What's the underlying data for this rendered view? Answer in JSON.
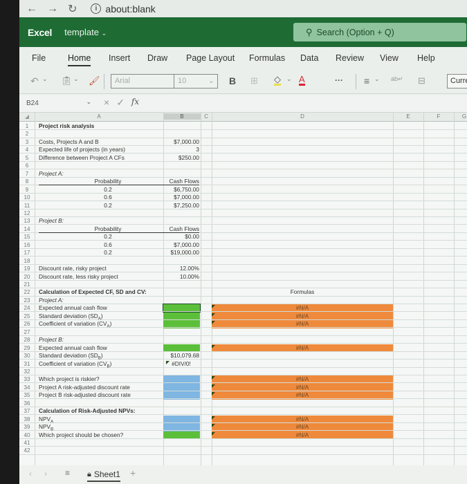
{
  "browser": {
    "back_icon": "arrow-left-icon",
    "forward_icon": "arrow-right-icon",
    "reload_icon": "reload-icon",
    "url": "about:blank"
  },
  "app": {
    "name": "Excel",
    "document": "template",
    "search_placeholder": "Search (Option + Q)"
  },
  "ribbon": {
    "tabs": [
      "File",
      "Home",
      "Insert",
      "Draw",
      "Page Layout",
      "Formulas",
      "Data",
      "Review",
      "View",
      "Help"
    ],
    "active_tab": "Home",
    "font_name": "Arial",
    "font_size": "10",
    "bold_label": "B",
    "more_label": "···",
    "number_format": "Currency"
  },
  "formula_bar": {
    "name_box": "B24",
    "cancel_icon": "×",
    "enter_icon": "✓",
    "fx_label": "fx",
    "value": ""
  },
  "columns": [
    "A",
    "B",
    "C",
    "D",
    "E",
    "F",
    "G"
  ],
  "selected_column": "B",
  "rows": [
    {
      "n": "1",
      "a": "Project risk analysis",
      "a_style": "bold"
    },
    {
      "n": "2"
    },
    {
      "n": "3",
      "a": "Costs, Projects A and B",
      "b": "$7,000.00"
    },
    {
      "n": "4",
      "a": "Expected life of projects (in years)",
      "b": "3"
    },
    {
      "n": "5",
      "a": "Difference between Project A CFs",
      "b": "$250.00"
    },
    {
      "n": "6"
    },
    {
      "n": "7",
      "a": "Project A:",
      "a_style": "ital"
    },
    {
      "n": "8",
      "mid": "Probability",
      "b": "Cash Flows"
    },
    {
      "n": "9",
      "mid": "0.2",
      "b": "$6,750.00"
    },
    {
      "n": "10",
      "mid": "0.6",
      "b": "$7,000.00"
    },
    {
      "n": "11",
      "mid": "0.2",
      "b": "$7,250.00"
    },
    {
      "n": "12"
    },
    {
      "n": "13",
      "a": "Project B:",
      "a_style": "ital"
    },
    {
      "n": "14",
      "mid": "Probability",
      "b": "Cash Flows"
    },
    {
      "n": "15",
      "mid": "0.2",
      "b": "$0.00"
    },
    {
      "n": "16",
      "mid": "0.6",
      "b": "$7,000.00"
    },
    {
      "n": "17",
      "mid": "0.2",
      "b": "$19,000.00"
    },
    {
      "n": "18"
    },
    {
      "n": "19",
      "a": "Discount rate, risky project",
      "b": "12.00%"
    },
    {
      "n": "20",
      "a": "Discount rate, less risky project",
      "b": "10.00%"
    },
    {
      "n": "21"
    },
    {
      "n": "22",
      "a": "Calculation of Expected CF, SD and CV:",
      "a_style": "bold",
      "d": "Formulas"
    },
    {
      "n": "23",
      "a": "Project A:",
      "a_style": "ital"
    },
    {
      "n": "24",
      "a": "Expected annual cash flow",
      "d": "#N/A"
    },
    {
      "n": "25",
      "a": "Standard deviation (SDA)",
      "d": "#N/A"
    },
    {
      "n": "26",
      "a": "Coefficient of variation (CVA)",
      "d": "#N/A"
    },
    {
      "n": "27"
    },
    {
      "n": "28",
      "a": "Project B:",
      "a_style": "ital"
    },
    {
      "n": "29",
      "a": "Expected annual cash flow",
      "d": "#N/A"
    },
    {
      "n": "30",
      "a": "Standard deviation (SDB)",
      "b": "$10,079.68"
    },
    {
      "n": "31",
      "a": "Coefficient of variation (CVB)",
      "b": "#DIV/0!"
    },
    {
      "n": "32"
    },
    {
      "n": "33",
      "a": "Which project is riskier?",
      "d": "#N/A"
    },
    {
      "n": "34",
      "a": "Project A risk-adjusted discount rate",
      "d": "#N/A"
    },
    {
      "n": "35",
      "a": "Project B risk-adjusted discount rate",
      "d": "#N/A"
    },
    {
      "n": "36"
    },
    {
      "n": "37",
      "a": "Calculation of Risk-Adjusted NPVs:",
      "a_style": "bold"
    },
    {
      "n": "38",
      "a": "NPVA",
      "d": "#N/A"
    },
    {
      "n": "39",
      "a": "NPVB",
      "d": "#N/A"
    },
    {
      "n": "40",
      "a": "Which project should be chosen?",
      "d": "#N/A"
    },
    {
      "n": "41"
    },
    {
      "n": "42"
    }
  ],
  "fills": {
    "green": "#5cbf3a",
    "blue": "#7fb6e2",
    "orange": "#ef8a3c"
  },
  "sheets": {
    "tabs": [
      "Sheet1"
    ],
    "active": "Sheet1",
    "add_label": "+"
  }
}
